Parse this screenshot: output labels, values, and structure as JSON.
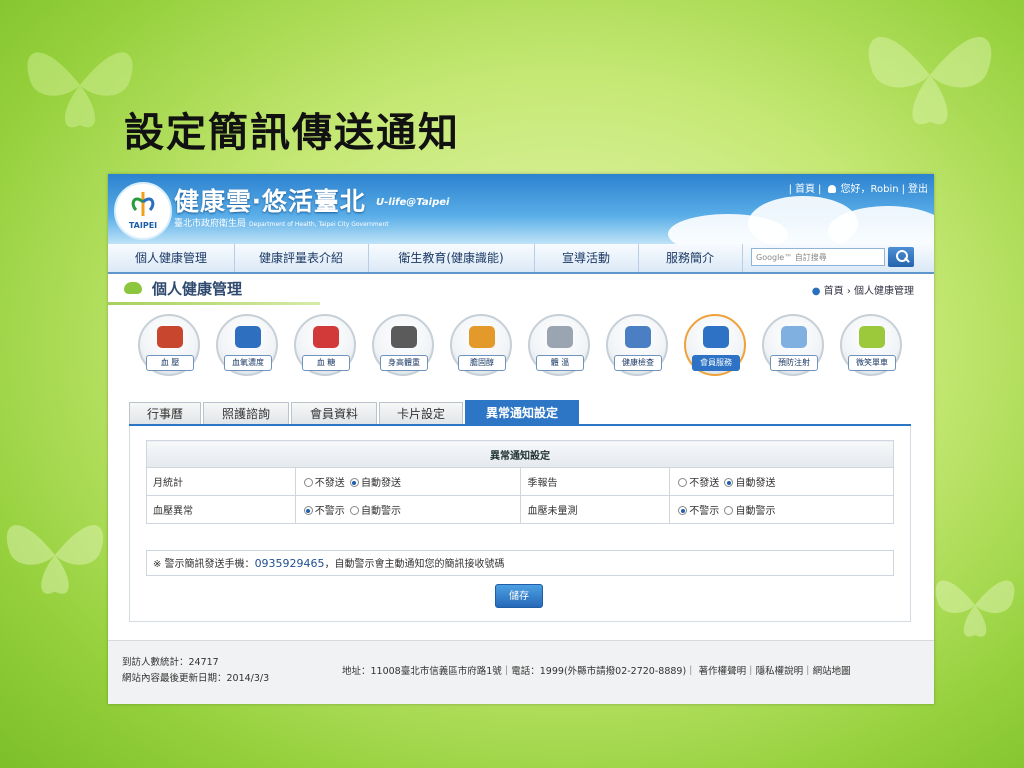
{
  "slide": {
    "title": "設定簡訊傳送通知"
  },
  "site": {
    "logo_seal_text": "TAIPEI",
    "logo_main": "健康雲‧悠活臺北",
    "logo_sub_en": "U-life@Taipei",
    "logo_sub": "臺北市政府衛生局",
    "logo_sub_eng": "Department of Health, Taipei City Government",
    "top_links": {
      "home": "首頁",
      "greeting": "您好，Robin",
      "logout": "登出"
    }
  },
  "nav": {
    "items": [
      "個人健康管理",
      "健康評量表介紹",
      "衛生教育(健康識能)",
      "宣導活動",
      "服務簡介"
    ],
    "search_placeholder": "Google™ 自訂搜尋"
  },
  "section": {
    "title": "個人健康管理",
    "breadcrumb": [
      "首頁",
      "個人健康管理"
    ]
  },
  "icons": [
    {
      "label": "血 壓",
      "icon": "blood-pressure-icon",
      "color": "#c8452e"
    },
    {
      "label": "血氧濃度",
      "icon": "oximeter-icon",
      "color": "#2f6fbf"
    },
    {
      "label": "血 糖",
      "icon": "glucose-meter-icon",
      "color": "#d23a3a"
    },
    {
      "label": "身高體重",
      "icon": "scale-icon",
      "color": "#5b5b5b"
    },
    {
      "label": "膽固醇",
      "icon": "cholesterol-icon",
      "color": "#e39a2b"
    },
    {
      "label": "體 溫",
      "icon": "thermometer-icon",
      "color": "#9aa5b1"
    },
    {
      "label": "健康檢查",
      "icon": "health-check-icon",
      "color": "#4a7fc4"
    },
    {
      "label": "會員服務",
      "icon": "member-service-icon",
      "color": "#2d72c4",
      "active": true
    },
    {
      "label": "預防注射",
      "icon": "vaccine-icon",
      "color": "#7fb0e0"
    },
    {
      "label": "微笑單車",
      "icon": "ubike-icon",
      "color": "#9cc83c"
    }
  ],
  "tabs": [
    "行事曆",
    "照護諮詢",
    "會員資料",
    "卡片設定",
    "異常通知設定"
  ],
  "settings": {
    "header": "異常通知設定",
    "rows": [
      {
        "label_a": "月統計",
        "opt_a1": "不發送",
        "opt_a2": "自動發送",
        "label_b": "季報告",
        "opt_b1": "不發送",
        "opt_b2": "自動發送"
      },
      {
        "label_a": "血壓異常",
        "opt_a1": "不警示",
        "opt_a2": "自動警示",
        "label_b": "血壓未量測",
        "opt_b1": "不警示",
        "opt_b2": "自動警示"
      }
    ]
  },
  "note": {
    "prefix": "※ 警示簡訊發送手機：",
    "phone": "0935929465",
    "suffix": "，自動警示會主動通知您的簡訊接收號碼"
  },
  "save_label": "儲存",
  "footer": {
    "visitors": "到訪人數統計：24717",
    "updated": "網站內容最後更新日期：2014/3/3",
    "address": "地址：11008臺北市信義區市府路1號｜電話：1999(外縣市請撥02-2720-8889)｜ 著作權聲明｜隱私權說明｜網站地圖"
  }
}
